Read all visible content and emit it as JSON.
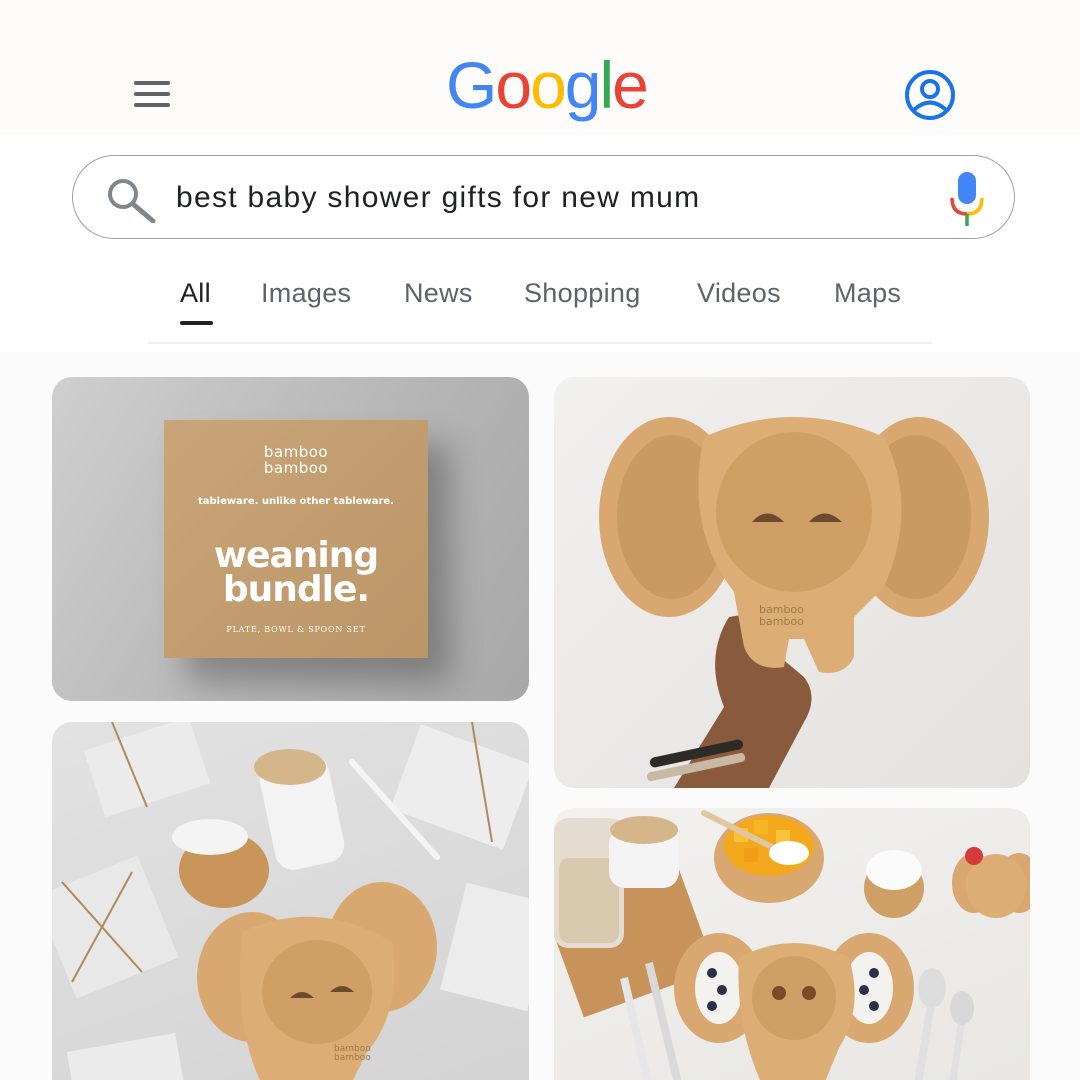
{
  "header": {
    "logo_letters": [
      "G",
      "o",
      "o",
      "g",
      "l",
      "e"
    ],
    "colors": {
      "blue": "#4285f4",
      "red": "#ea4335",
      "yellow": "#fbbc05",
      "green": "#34a853"
    }
  },
  "search": {
    "query": "best baby shower gifts for new mum",
    "icons": [
      "search-icon",
      "mic-icon"
    ]
  },
  "tabs": [
    {
      "label": "All",
      "active": true
    },
    {
      "label": "Images",
      "active": false
    },
    {
      "label": "News",
      "active": false
    },
    {
      "label": "Shopping",
      "active": false
    },
    {
      "label": "Videos",
      "active": false
    },
    {
      "label": "Maps",
      "active": false
    }
  ],
  "results": {
    "card1": {
      "brand_line1": "bamboo",
      "brand_line2": "bamboo",
      "tagline": "tableware. unlike other tableware.",
      "title_line1": "weaning",
      "title_line2": "bundle.",
      "subtitle": "PLATE, BOWL & SPOON SET"
    },
    "card2": {
      "engraving_line1": "bamboo",
      "engraving_line2": "bamboo"
    },
    "card3": {
      "engraving_line1": "bamboo",
      "engraving_line2": "bamboo"
    }
  }
}
